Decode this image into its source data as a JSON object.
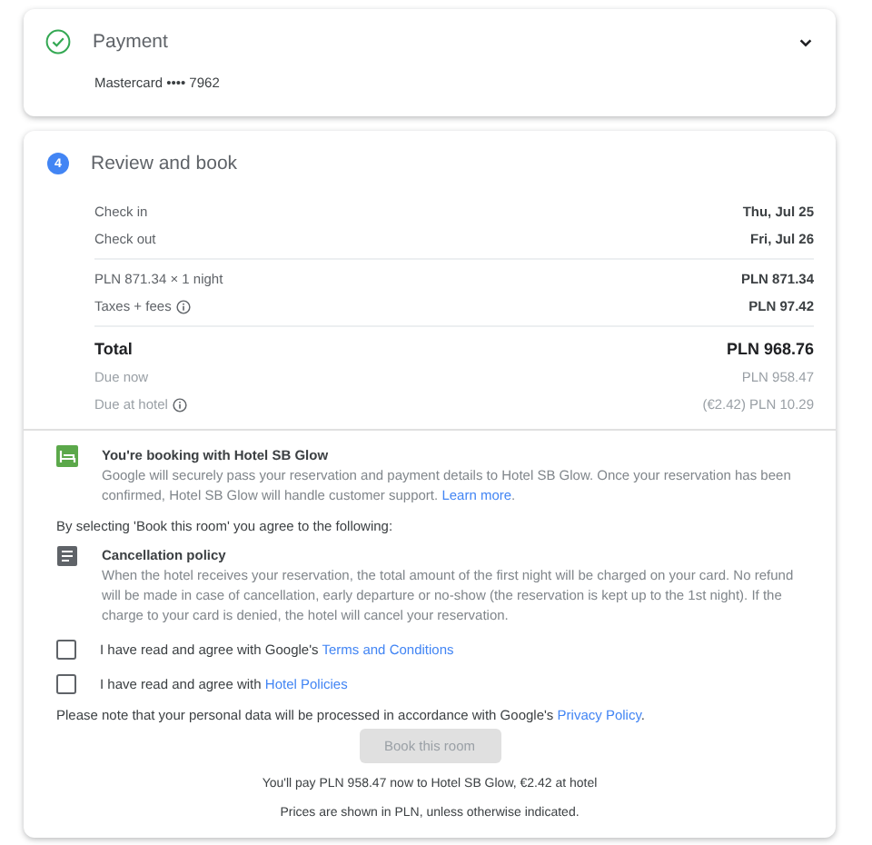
{
  "payment": {
    "title": "Payment",
    "completed": true,
    "card": "Mastercard •••• 7962"
  },
  "review": {
    "step": "4",
    "title": "Review and book",
    "stay": [
      {
        "label": "Check in",
        "value": "Thu, Jul 25"
      },
      {
        "label": "Check out",
        "value": "Fri, Jul 26"
      }
    ],
    "prices": [
      {
        "label": "PLN 871.34 × 1 night",
        "value": "PLN 871.34",
        "info": false
      },
      {
        "label": "Taxes + fees",
        "value": "PLN 97.42",
        "info": true
      }
    ],
    "totals": [
      {
        "kind": "total",
        "label": "Total",
        "value": "PLN 968.76",
        "info": false
      },
      {
        "kind": "sub",
        "label": "Due now",
        "value": "PLN 958.47",
        "info": false
      },
      {
        "kind": "sub",
        "label": "Due at hotel",
        "value": "(€2.42) PLN 10.29",
        "info": true
      }
    ]
  },
  "notice": {
    "title": "You're booking with Hotel SB Glow",
    "text": "Google will securely pass your reservation and payment details to Hotel SB Glow. Once your reservation has been confirmed, Hotel SB Glow will handle customer support.",
    "link": "Learn more",
    "suffix": "."
  },
  "agree_intro": "By selecting 'Book this room' you agree to the following:",
  "policy": {
    "title": "Cancellation policy",
    "text": "When the hotel receives your reservation, the total amount of the first night will be charged on your card. No refund will be made in case of cancellation, early departure or no-show (the reservation is kept up to the 1st night). If the charge to your card is denied, the hotel will cancel your reservation."
  },
  "agreements": [
    {
      "text": "I have read and agree with Google's",
      "link": "Terms and Conditions",
      "checked": false
    },
    {
      "text": "I have read and agree with",
      "link": "Hotel Policies",
      "checked": false
    }
  ],
  "privacy": {
    "text": "Please note that your personal data will be processed in accordance with Google's",
    "link": "Privacy Policy",
    "suffix": "."
  },
  "button": {
    "label": "Book this room",
    "disabled": true
  },
  "pay_note": "You'll pay PLN 958.47 now to Hotel SB Glow, €2.42 at hotel",
  "currency_note": "Prices are shown in PLN, unless otherwise indicated."
}
